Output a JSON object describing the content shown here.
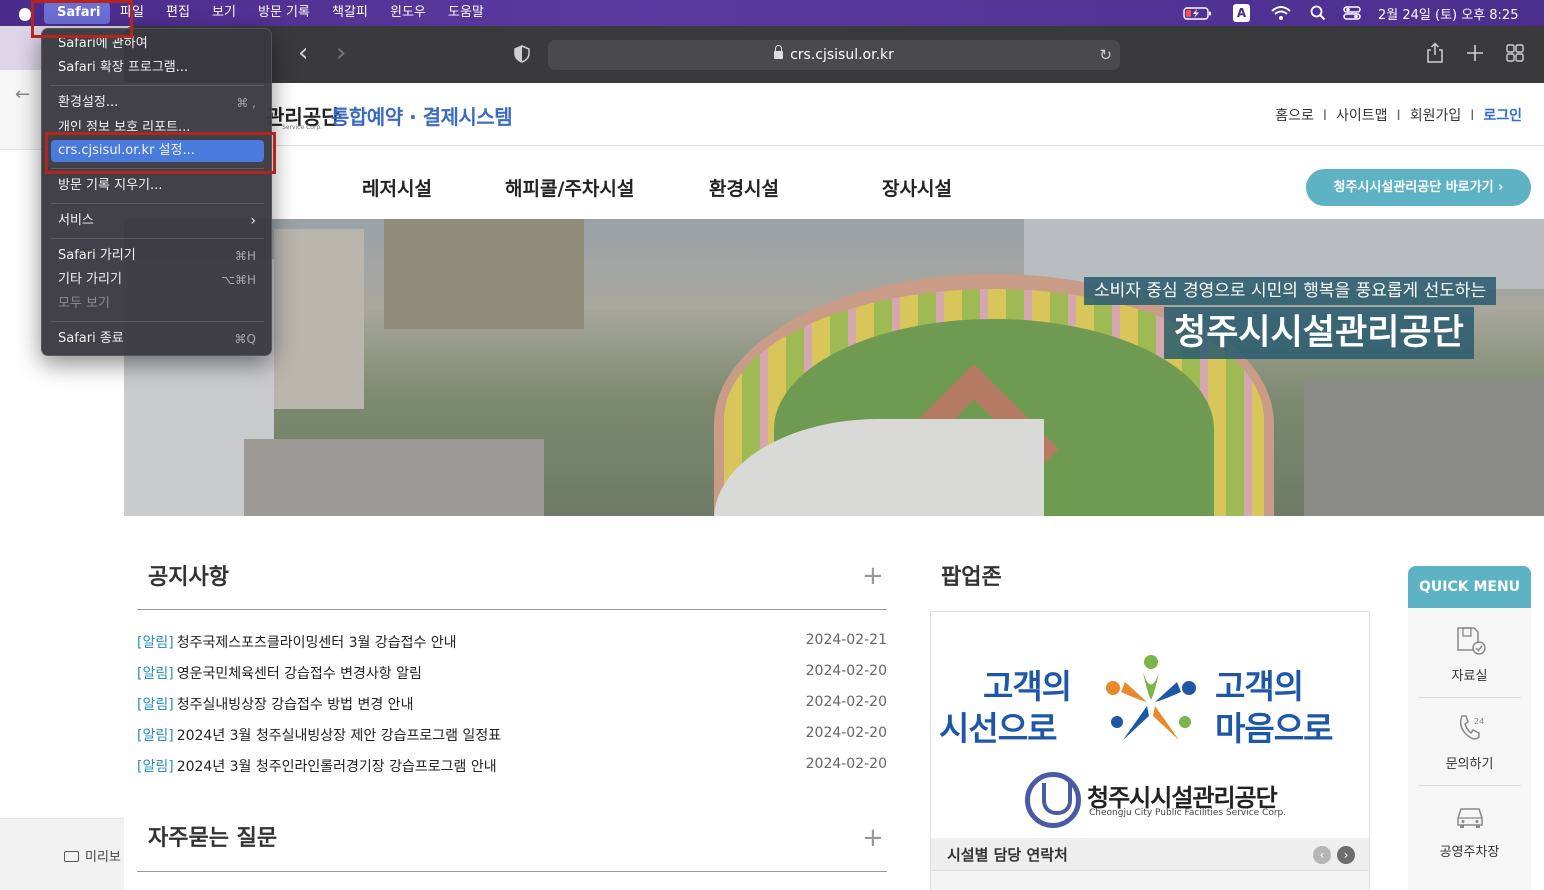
{
  "menubar": {
    "app": "Safari",
    "items": [
      "파일",
      "편집",
      "보기",
      "방문 기록",
      "책갈피",
      "윈도우",
      "도움말"
    ],
    "input_indicator": "A",
    "clock": "2월 24일 (토) 오후 8:25"
  },
  "safari_menu": {
    "about": "Safari에 관하여",
    "extensions": "Safari 확장 프로그램...",
    "settings": "환경설정...",
    "settings_shortcut": "⌘ ,",
    "privacy_report": "개인 정보 보호 리포트...",
    "site_settings": "crs.cjsisul.or.kr 설정...",
    "clear_history": "방문 기록 지우기...",
    "services": "서비스",
    "hide_safari": "Safari 가리기",
    "hide_safari_shortcut": "⌘H",
    "hide_others": "기타 가리기",
    "hide_others_shortcut": "⌥⌘H",
    "show_all": "모두 보기",
    "quit": "Safari 종료",
    "quit_shortcut": "⌘Q"
  },
  "background_window": {
    "preview_label": "미리보"
  },
  "browser": {
    "url": "crs.cjsisul.or.kr"
  },
  "site": {
    "logo_text": "관리공단",
    "logo_subtext": "Service Corp.",
    "title": "통합예약 · 결제시스템",
    "top_links": [
      "홈으로",
      "사이트맵",
      "회원가입"
    ],
    "login": "로그인",
    "separator": "I",
    "nav": [
      "레저시설",
      "해피콜/주차시설",
      "환경시설",
      "장사시설"
    ],
    "goto_button": "청주시시설관리공단 바로가기 ›",
    "hero_slogan": "소비자 중심 경영으로 시민의 행복을 풍요롭게 선도하는",
    "hero_title": "청주시시설관리공단"
  },
  "notices": {
    "title": "공지사항",
    "plus": "+",
    "items": [
      {
        "tag": "[알림]",
        "title": "청주국제스포츠클라이밍센터 3월 강습접수 안내",
        "date": "2024-02-21"
      },
      {
        "tag": "[알림]",
        "title": "영운국민체육센터 강습접수 변경사항 알림",
        "date": "2024-02-20"
      },
      {
        "tag": "[알림]",
        "title": "청주실내빙상장 강습접수 방법 변경 안내",
        "date": "2024-02-20"
      },
      {
        "tag": "[알림]",
        "title": "2024년 3월 청주실내빙상장 제안 강습프로그램 일정표",
        "date": "2024-02-20"
      },
      {
        "tag": "[알림]",
        "title": "2024년 3월 청주인라인롤러경기장 강습프로그램 안내",
        "date": "2024-02-20"
      }
    ]
  },
  "faq": {
    "title": "자주묻는 질문",
    "plus": "+"
  },
  "popup_zone": {
    "title": "팝업존",
    "phrase_left_1": "고객의",
    "phrase_left_2": "시선으로",
    "phrase_right_1": "고객의",
    "phrase_right_2": "마음으로",
    "org_name": "청주시시설관리공단",
    "org_name_en": "Cheongju City Public Facilities Service Corp.",
    "caption": "시설별 담당 연락처",
    "prev": "‹",
    "next": "›"
  },
  "quick_menu": {
    "title": "QUICK MENU",
    "items": [
      {
        "label": "자료실",
        "icon": "document-check-icon"
      },
      {
        "label": "문의하기",
        "icon": "phone-24-icon"
      },
      {
        "label": "공영주차장",
        "icon": "car-icon"
      }
    ]
  },
  "colors": {
    "accent_teal": "#5db3c4",
    "title_blue": "#3a6bc1",
    "notice_tag": "#2a8fc0",
    "highlight_red": "#b3261e",
    "menu_selection": "#4a7bdc"
  }
}
